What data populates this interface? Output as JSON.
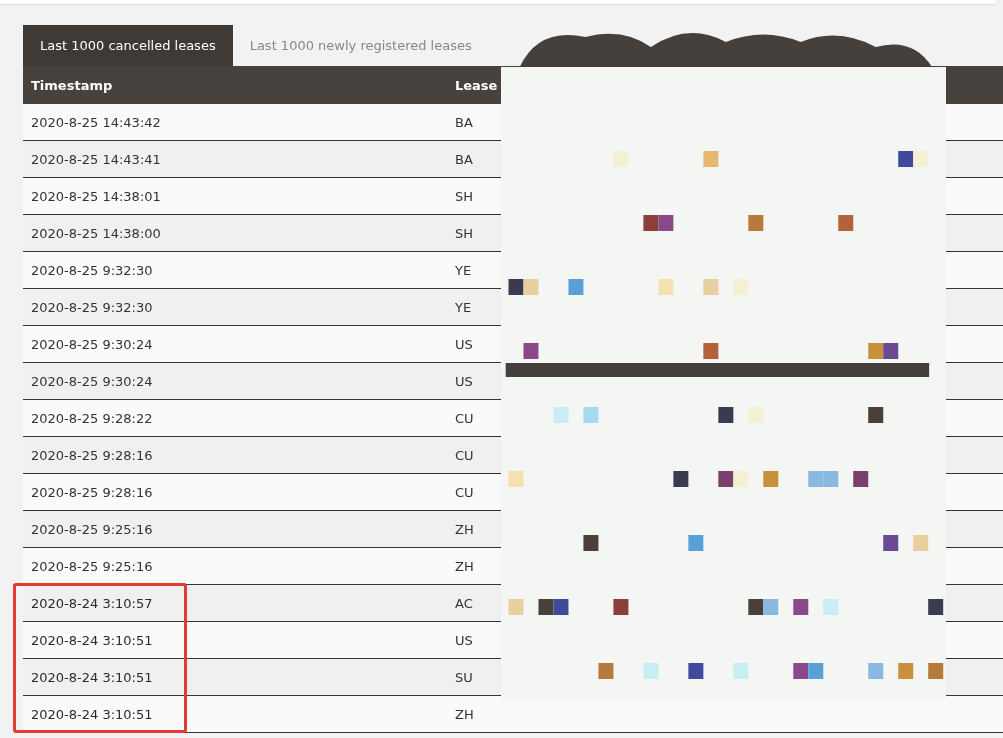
{
  "tabs": [
    {
      "label": "Last 1000 cancelled leases",
      "selected": true
    },
    {
      "label": "Last 1000 newly registered leases",
      "selected": false
    }
  ],
  "table": {
    "columns": [
      "Timestamp",
      "Lease"
    ],
    "rows": [
      {
        "timestamp": "2020-8-25 14:43:42",
        "lease": "BA",
        "highlighted": false
      },
      {
        "timestamp": "2020-8-25 14:43:41",
        "lease": "BA",
        "highlighted": false
      },
      {
        "timestamp": "2020-8-25 14:38:01",
        "lease": "SH",
        "highlighted": false
      },
      {
        "timestamp": "2020-8-25 14:38:00",
        "lease": "SH",
        "highlighted": false
      },
      {
        "timestamp": "2020-8-25 9:32:30",
        "lease": "YE",
        "highlighted": false
      },
      {
        "timestamp": "2020-8-25 9:32:30",
        "lease": "YE",
        "highlighted": false
      },
      {
        "timestamp": "2020-8-25 9:30:24",
        "lease": "US",
        "highlighted": false
      },
      {
        "timestamp": "2020-8-25 9:30:24",
        "lease": "US",
        "highlighted": false
      },
      {
        "timestamp": "2020-8-25 9:28:22",
        "lease": "CU",
        "highlighted": false
      },
      {
        "timestamp": "2020-8-25 9:28:16",
        "lease": "CU",
        "highlighted": false
      },
      {
        "timestamp": "2020-8-25 9:28:16",
        "lease": "CU",
        "highlighted": false
      },
      {
        "timestamp": "2020-8-25 9:25:16",
        "lease": "ZH",
        "highlighted": false
      },
      {
        "timestamp": "2020-8-25 9:25:16",
        "lease": "ZH",
        "highlighted": false
      },
      {
        "timestamp": "2020-8-24 3:10:57",
        "lease": "AC",
        "highlighted": true
      },
      {
        "timestamp": "2020-8-24 3:10:51",
        "lease": "US",
        "highlighted": true
      },
      {
        "timestamp": "2020-8-24 3:10:51",
        "lease": "SU",
        "highlighted": true
      },
      {
        "timestamp": "2020-8-24 3:10:51",
        "lease": "ZH",
        "highlighted": true
      }
    ]
  }
}
